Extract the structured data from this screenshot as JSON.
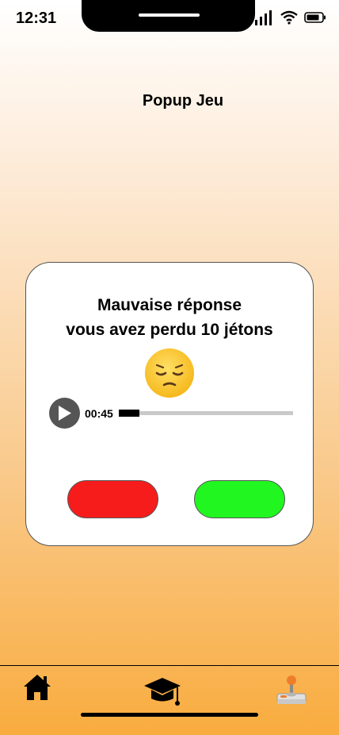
{
  "status_bar": {
    "time": "12:31"
  },
  "header": {
    "title": "Popup Jeu"
  },
  "popup": {
    "line1": "Mauvaise réponse",
    "line2": "vous avez perdu 10 jétons",
    "emoji_icon": "pensive-face-icon",
    "audio": {
      "time": "00:45",
      "progress": 0.12
    },
    "buttons": {
      "left_color": "#f61c1c",
      "right_color": "#21f621"
    }
  },
  "nav": {
    "items": [
      {
        "icon": "home-icon"
      },
      {
        "icon": "graduation-cap-icon"
      },
      {
        "icon": "joystick-icon"
      }
    ]
  }
}
